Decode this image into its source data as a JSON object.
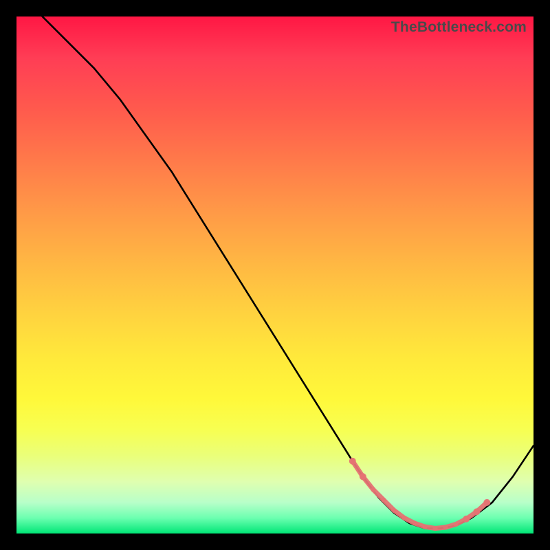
{
  "watermark": "TheBottleneck.com",
  "colors": {
    "background": "#000000",
    "marker": "#e57373",
    "line": "#000000",
    "gradient_top": "#ff1744",
    "gradient_bottom": "#00e676"
  },
  "chart_data": {
    "type": "line",
    "title": "",
    "xlabel": "",
    "ylabel": "",
    "xlim": [
      0,
      100
    ],
    "ylim": [
      0,
      100
    ],
    "grid": false,
    "series": [
      {
        "name": "bottleneck-curve",
        "x": [
          5,
          10,
          15,
          20,
          25,
          30,
          35,
          40,
          45,
          50,
          55,
          60,
          65,
          67,
          70,
          73,
          76,
          79,
          82,
          85,
          88,
          92,
          96,
          100
        ],
        "values": [
          100,
          95,
          90,
          84,
          77,
          70,
          62,
          54,
          46,
          38,
          30,
          22,
          14,
          11,
          7,
          4,
          2,
          1,
          1,
          1.5,
          3,
          6,
          11,
          17
        ]
      }
    ],
    "markers": {
      "name": "highlight-range",
      "approx_x_start": 65,
      "approx_x_end": 92,
      "points_x": [
        65,
        67,
        69,
        71,
        73,
        75,
        77,
        79,
        81,
        83,
        85,
        87,
        89,
        91
      ],
      "points_y": [
        14,
        11,
        8.5,
        6.5,
        4.5,
        3,
        2,
        1.3,
        1,
        1.2,
        1.8,
        2.8,
        4.2,
        6
      ]
    }
  }
}
